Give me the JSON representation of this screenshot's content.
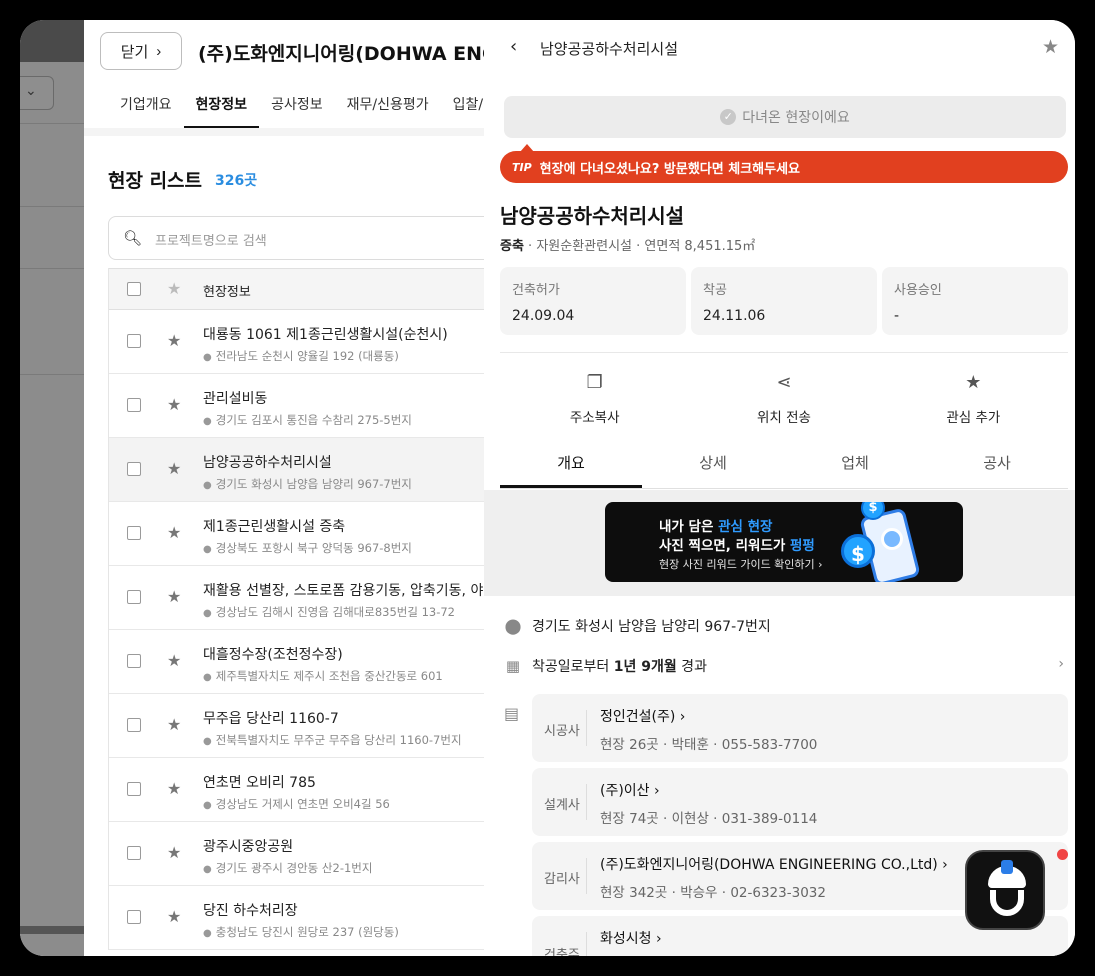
{
  "left_panel": {},
  "company": {
    "close_label": "닫기",
    "close_chevron": "›",
    "title": "(주)도화엔지니어링(DOHWA ENGIN",
    "tabs": [
      "기업개요",
      "현장정보",
      "공사정보",
      "재무/신용평가",
      "입찰/"
    ]
  },
  "site_list": {
    "title": "현장 리스트",
    "count": "326곳",
    "search_placeholder": "프로젝트명으로 검색",
    "header_label": "현장정보",
    "rows": [
      {
        "name": "대룡동 1061 제1종근린생활시설(순천시)",
        "address": "전라남도 순천시 양율길 192 (대룡동)"
      },
      {
        "name": "관리설비동",
        "address": "경기도 김포시 통진읍 수참리 275-5번지"
      },
      {
        "name": "남양공공하수처리시설",
        "address": "경기도 화성시 남양읍 남양리 967-7번지"
      },
      {
        "name": "제1종근린생활시설 증축",
        "address": "경상북도 포항시 북구 양덕동 967-8번지"
      },
      {
        "name": "재활용 선별장, 스토로폼 감용기동, 압축기동, 야-",
        "address": "경상남도 김해시 진영읍 김해대로835번길 13-72"
      },
      {
        "name": "대흘정수장(조천정수장)",
        "address": "제주특별자치도 제주시 조천읍 중산간동로 601"
      },
      {
        "name": "무주읍 당산리 1160-7",
        "address": "전북특별자치도 무주군 무주읍 당산리 1160-7번지"
      },
      {
        "name": "연초면 오비리 785",
        "address": "경상남도 거제시 연초면 오비4길 56"
      },
      {
        "name": "광주시중앙공원",
        "address": "경기도 광주시 경안동 산2-1번지"
      },
      {
        "name": "당진 하수처리장",
        "address": "충청남도 당진시 원당로 237 (원당동)"
      }
    ]
  },
  "detail": {
    "header_title": "남양공공하수처리시설",
    "visited_label": "다녀온 현장이에요",
    "tip_label": "TIP",
    "tip_text": "현장에 다녀오셨나요? 방문했다면 체크해두세요",
    "site_name": "남양공공하수처리시설",
    "type_bold": "증축",
    "type_rest": " · 자원순환관련시설 · 연면적 8,451.15㎡",
    "dates": [
      {
        "label": "건축허가",
        "value": "24.09.04"
      },
      {
        "label": "착공",
        "value": "24.11.06"
      },
      {
        "label": "사용승인",
        "value": "-"
      }
    ],
    "actions": [
      {
        "icon": "copy-icon",
        "label": "주소복사"
      },
      {
        "icon": "share-icon",
        "label": "위치 전송"
      },
      {
        "icon": "star-icon",
        "label": "관심 추가"
      }
    ],
    "tabs": [
      "개요",
      "상세",
      "업체",
      "공사"
    ],
    "banner": {
      "line1_a": "내가 담은 ",
      "line1_b": "관심 현장",
      "line2_a": "사진 찍으면, 리워드가 ",
      "line2_b": "펑펑",
      "line3": "현장 사진 리워드 가이드 확인하기 ›"
    },
    "address": "경기도 화성시 남양읍 남양리 967-7번지",
    "elapsed_pre": "착공일로부터 ",
    "elapsed_bold": "1년 9개월",
    "elapsed_post": " 경과",
    "parties": [
      {
        "role": "시공사",
        "name": "정인건설(주)",
        "info": "현장 26곳 · 박태훈 · 055-583-7700"
      },
      {
        "role": "설계사",
        "name": "(주)이산",
        "info": "현장 74곳 · 이현상 · 031-389-0114"
      },
      {
        "role": "감리사",
        "name": "(주)도화엔지니어링(DOHWA ENGINEERING CO.,Ltd)",
        "info": "현장 342곳 · 박승우 · 02-6323-3032"
      },
      {
        "role": "건축주",
        "name": "화성시청",
        "info": ""
      }
    ]
  },
  "colors": {
    "accent": "#2b8de0",
    "tip": "#e1401f",
    "fab_badge": "#f04444"
  }
}
